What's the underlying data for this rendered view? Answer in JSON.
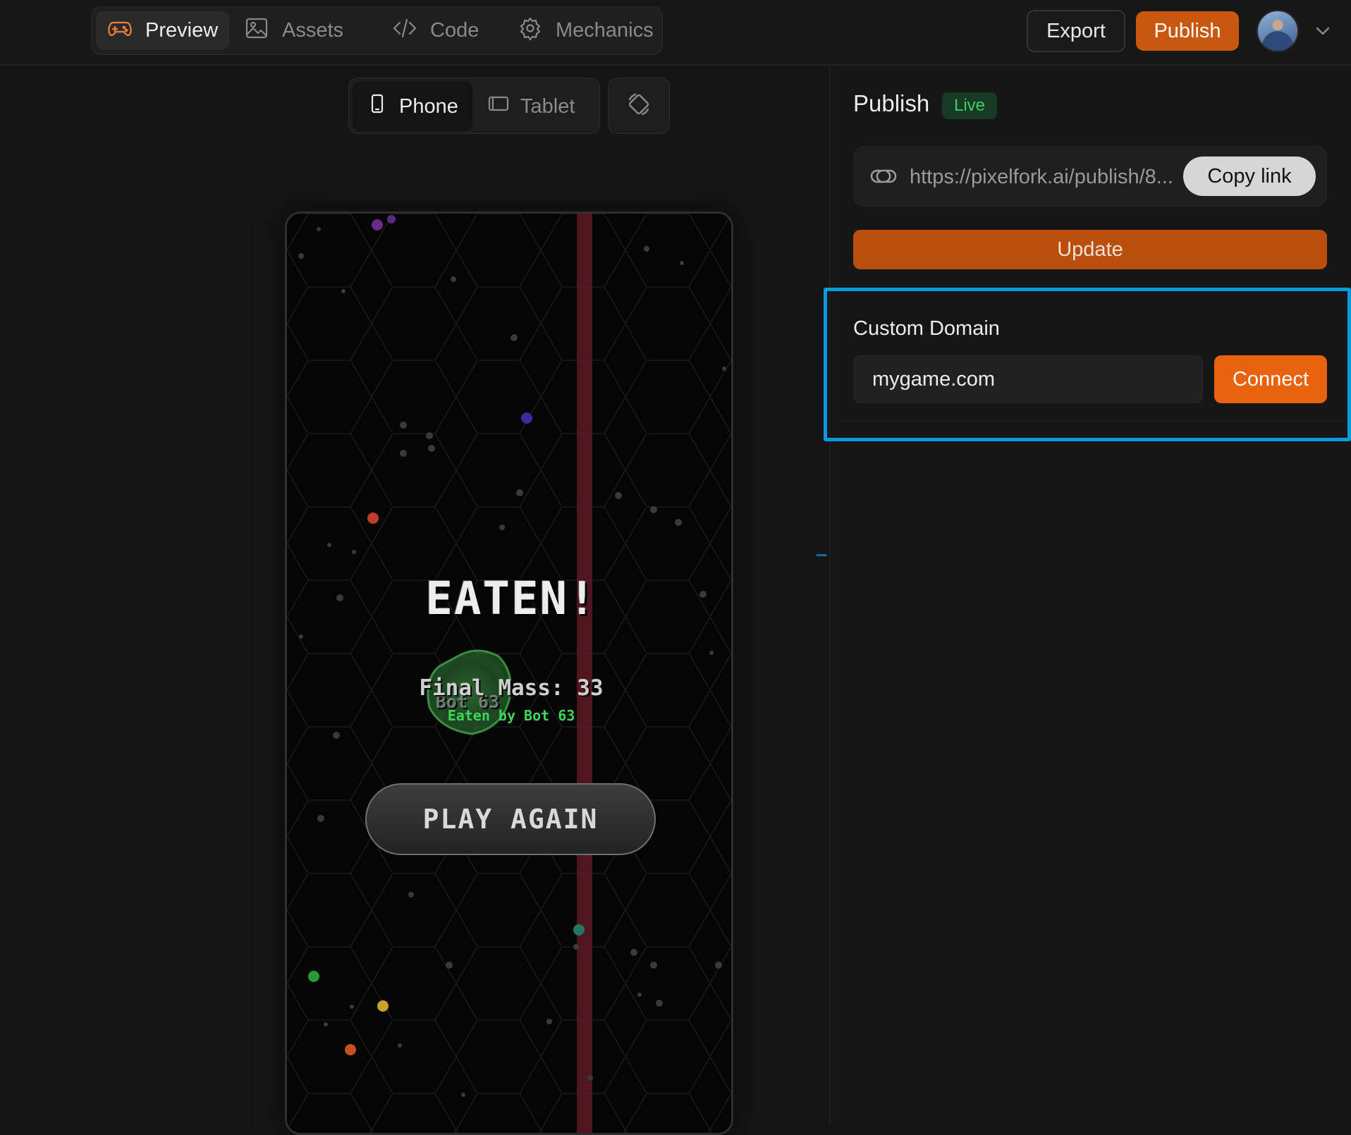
{
  "header": {
    "tabs": [
      {
        "label": "Preview",
        "icon": "gamepad-icon",
        "active": true
      },
      {
        "label": "Assets",
        "icon": "image-icon",
        "active": false
      },
      {
        "label": "Code",
        "icon": "code-icon",
        "active": false
      },
      {
        "label": "Mechanics",
        "icon": "gear-icon",
        "active": false
      }
    ],
    "export_label": "Export",
    "publish_label": "Publish",
    "avatar_icon": "user-avatar",
    "menu_icon": "chevron-down-icon"
  },
  "device_toggle": {
    "options": [
      {
        "label": "Phone",
        "icon": "phone-icon",
        "active": true
      },
      {
        "label": "Tablet",
        "icon": "tablet-icon",
        "active": false
      }
    ],
    "rotate_icon": "rotate-icon"
  },
  "game": {
    "title": "EATEN!",
    "final_mass": "Final Mass: 33",
    "cell_label": "Bot 63",
    "eaten_by": "Eaten by Bot 63",
    "play_again_label": "PLAY AGAIN",
    "colors": {
      "background": "#050505",
      "border_line": "#5e1a26",
      "player_cell": "#1f4a24",
      "eaten_by_text": "#3fd45a"
    }
  },
  "publish_panel": {
    "title": "Publish",
    "status_badge": "Live",
    "url": "https://pixelfork.ai/publish/8...",
    "copy_label": "Copy link",
    "update_label": "Update",
    "custom_domain": {
      "label": "Custom Domain",
      "input_value": "mygame.com",
      "connect_label": "Connect"
    }
  },
  "colors": {
    "accent": "#e8620f",
    "highlight": "#0a9ae0",
    "live": "#3fcf66"
  }
}
